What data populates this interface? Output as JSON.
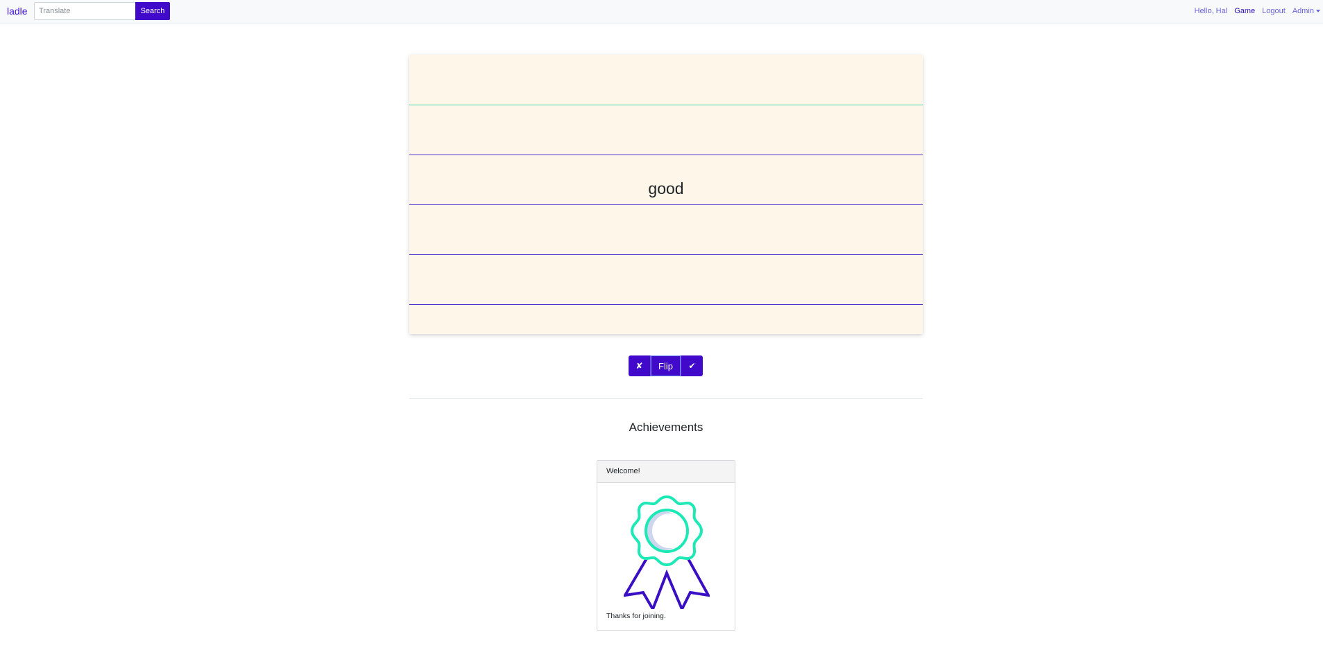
{
  "navbar": {
    "brand": "ladle",
    "search": {
      "placeholder": "Translate",
      "button_label": "Search"
    },
    "links": {
      "greeting": "Hello, Hal",
      "game": "Game",
      "logout": "Logout",
      "admin": "Admin"
    }
  },
  "flashcard": {
    "word": "good"
  },
  "controls": {
    "wrong_label": "✘",
    "flip_label": "Flip",
    "right_label": "✔"
  },
  "achievements": {
    "title": "Achievements",
    "items": [
      {
        "title": "Welcome!",
        "description": "Thanks for joining.",
        "icon": "award-ribbon-icon"
      }
    ]
  },
  "colors": {
    "primary": "#4109c9",
    "card_background": "#fdf6e9",
    "rule_green": "#38d9a9",
    "rule_purple": "#4a2fd0",
    "award_teal": "#1de9b6",
    "award_purple": "#3a0fc4"
  }
}
